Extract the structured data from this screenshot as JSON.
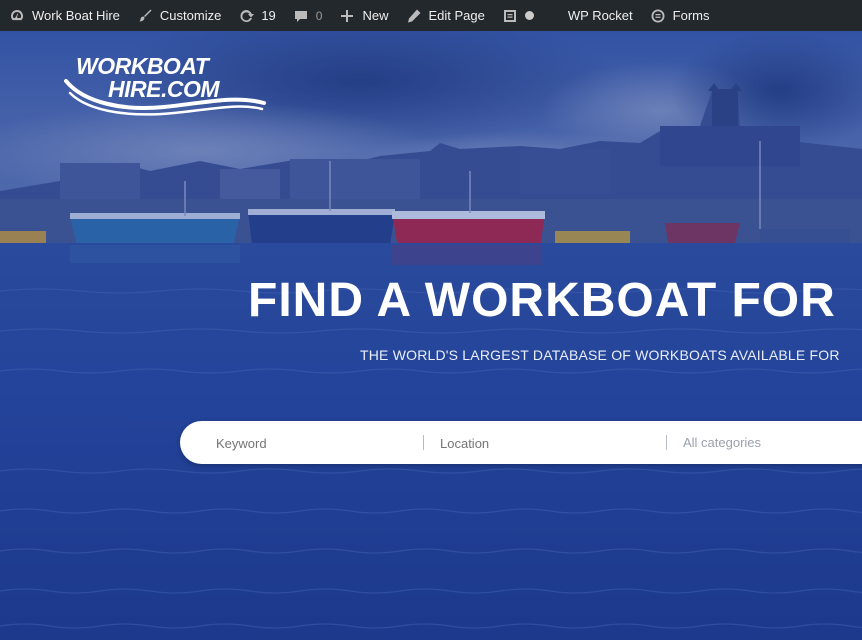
{
  "admin_bar": {
    "site_name": "Work Boat Hire",
    "customize": "Customize",
    "updates_count": "19",
    "comments_count": "0",
    "new_label": "New",
    "edit_page": "Edit Page",
    "wp_rocket": "WP Rocket",
    "forms": "Forms",
    "icons": [
      "dashboard-icon",
      "customize-brush-icon",
      "updates-icon",
      "comments-icon",
      "plus-icon",
      "edit-pencil-icon",
      "seo-icon",
      "status-dot-icon",
      "forms-icon"
    ]
  },
  "hero": {
    "logo_line1": "WORKBOAT",
    "logo_line2": "HIRE.COM",
    "headline": "FIND A WORKBOAT FOR",
    "subheadline": "THE WORLD'S LARGEST DATABASE OF WORKBOATS AVAILABLE FOR",
    "overlay_color": "#2a4aa0"
  },
  "search": {
    "keyword_placeholder": "Keyword",
    "location_placeholder": "Location",
    "category_value": "All categories"
  }
}
